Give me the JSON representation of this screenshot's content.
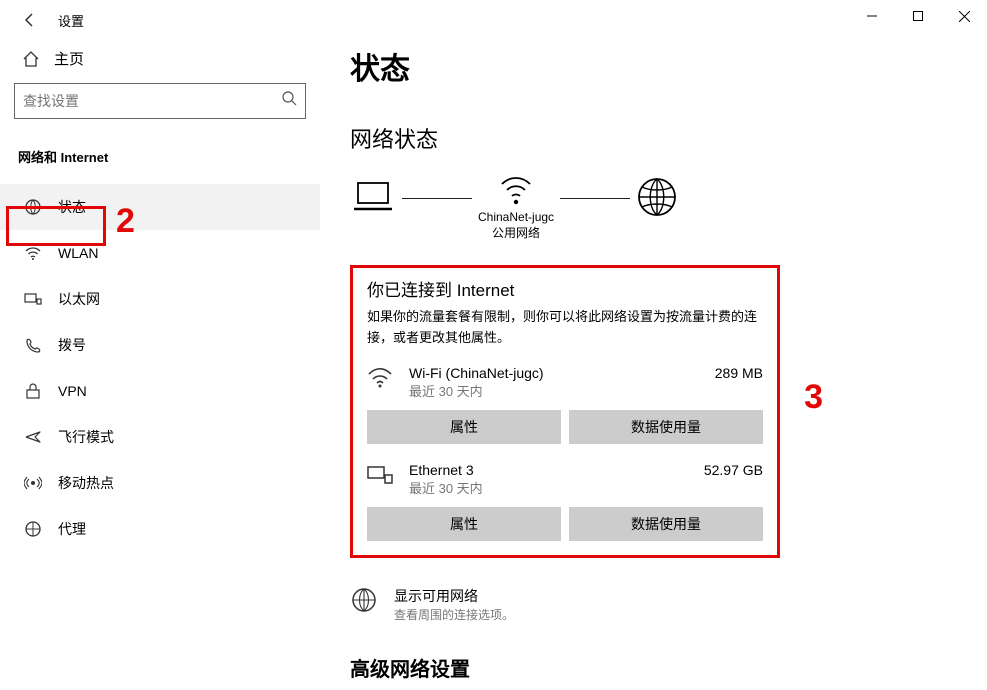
{
  "window": {
    "title": "设置",
    "controls": {
      "min": "minimize-icon",
      "max": "maximize-icon",
      "close": "close-icon"
    }
  },
  "sidebar": {
    "home": "主页",
    "search_placeholder": "查找设置",
    "category": "网络和 Internet",
    "items": [
      {
        "icon": "status-icon",
        "label": "状态",
        "active": true
      },
      {
        "icon": "wifi-icon",
        "label": "WLAN",
        "active": false
      },
      {
        "icon": "ethernet-icon",
        "label": "以太网",
        "active": false
      },
      {
        "icon": "dialup-icon",
        "label": "拨号",
        "active": false
      },
      {
        "icon": "vpn-icon",
        "label": "VPN",
        "active": false
      },
      {
        "icon": "airplane-icon",
        "label": "飞行模式",
        "active": false
      },
      {
        "icon": "hotspot-icon",
        "label": "移动热点",
        "active": false
      },
      {
        "icon": "proxy-icon",
        "label": "代理",
        "active": false
      }
    ]
  },
  "content": {
    "page_title": "状态",
    "net_status_heading": "网络状态",
    "diagram": {
      "ssid": "ChinaNet-jugc",
      "net_type": "公用网络"
    },
    "connected_title": "你已连接到 Internet",
    "connected_desc": "如果你的流量套餐有限制，则你可以将此网络设置为按流量计费的连接，或者更改其他属性。",
    "networks": [
      {
        "icon": "wifi-icon",
        "name": "Wi-Fi (ChinaNet-jugc)",
        "sub": "最近 30 天内",
        "amount": "289 MB"
      },
      {
        "icon": "ethernet-icon",
        "name": "Ethernet 3",
        "sub": "最近 30 天内",
        "amount": "52.97 GB"
      }
    ],
    "btn_props": "属性",
    "btn_usage": "数据使用量",
    "show_networks": {
      "title": "显示可用网络",
      "sub": "查看周围的连接选项。"
    },
    "adv_heading": "高级网络设置"
  },
  "annotations": {
    "num2": "2",
    "num3": "3"
  }
}
